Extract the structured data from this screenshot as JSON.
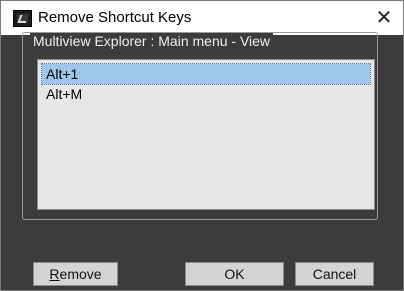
{
  "window": {
    "title": "Remove Shortcut Keys",
    "close_glyph": "✕"
  },
  "group": {
    "label": "Multiview Explorer : Main menu - View"
  },
  "shortcuts": [
    {
      "label": "Alt+1",
      "selected": true
    },
    {
      "label": "Alt+M",
      "selected": false
    }
  ],
  "buttons": {
    "remove_first": "R",
    "remove_rest": "emove",
    "ok": "OK",
    "cancel": "Cancel"
  },
  "colors": {
    "dialog_bg": "#3c3c3c",
    "selection": "#9dc6e8",
    "listbox_bg": "#e6e6e6"
  }
}
